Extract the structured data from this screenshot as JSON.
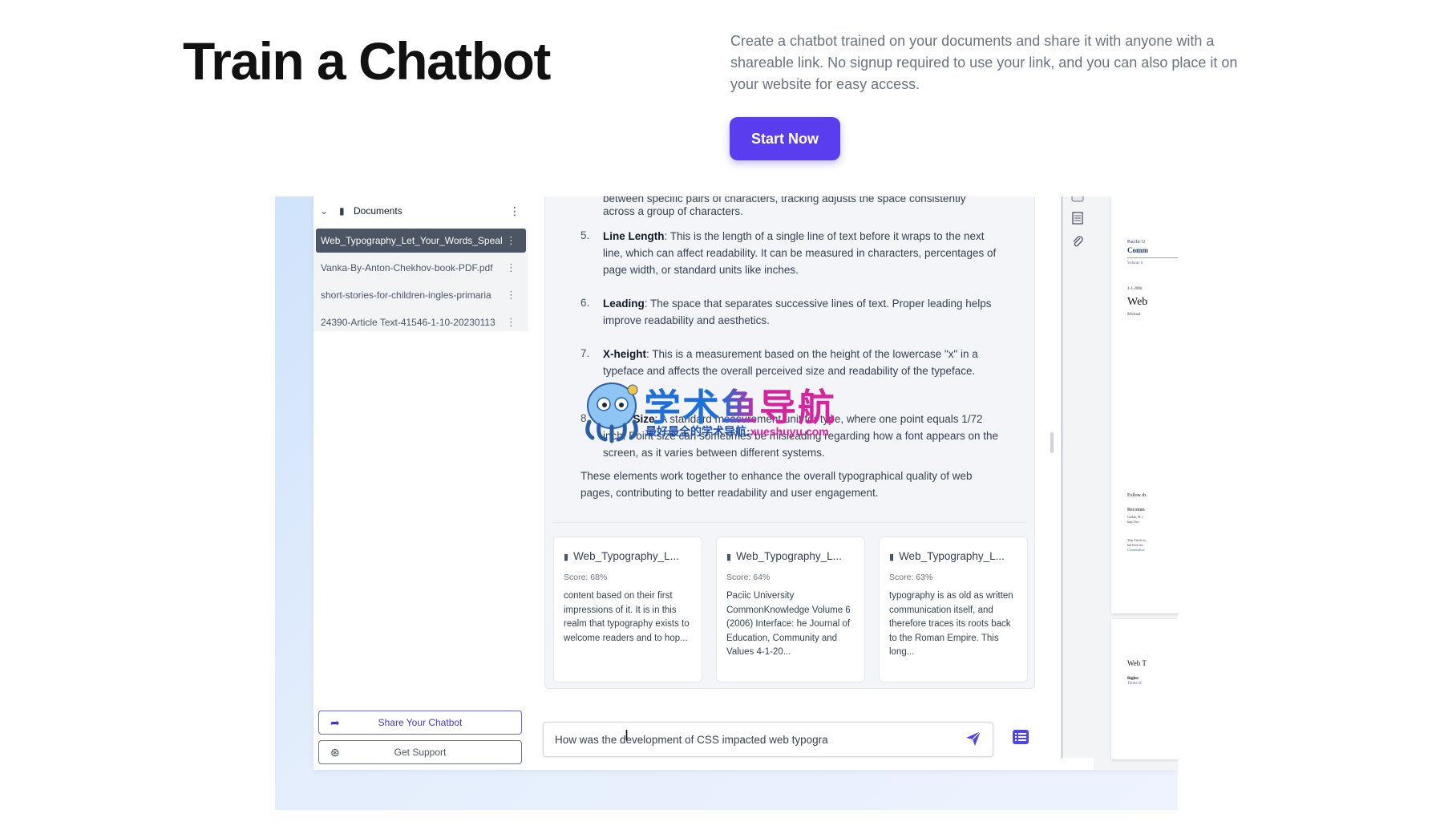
{
  "hero": {
    "title": "Train a Chatbot",
    "description": "Create a chatbot trained on your documents and share it with anyone with a shareable link. No signup required to use your link, and you can also place it on your website for easy access.",
    "cta": "Start Now"
  },
  "sidebar": {
    "section_label": "Documents",
    "documents": [
      "Web_Typography_Let_Your_Words_Speak",
      "Vanka-By-Anton-Chekhov-book-PDF.pdf",
      "short-stories-for-children-ingles-primaria",
      "24390-Article Text-41546-1-10-20230113"
    ],
    "active_index": 0,
    "share_label": "Share Your Chatbot",
    "support_label": "Get Support"
  },
  "chat": {
    "partial_top": "between specific pairs of characters, tracking adjusts the space consistently",
    "partial_top_2": "across a group of characters.",
    "items": [
      {
        "num": "5.",
        "term": "Line Length",
        "text": ": This is the length of a single line of text before it wraps to the next line, which can affect readability. It can be measured in characters, percentages of page width, or standard units like inches."
      },
      {
        "num": "6.",
        "term": "Leading",
        "text": ": The space that separates successive lines of text. Proper leading helps improve readability and aesthetics."
      },
      {
        "num": "7.",
        "term": "X-height",
        "text": ": This is a measurement based on the height of the lowercase \"x\" in a typeface and affects the overall perceived size and readability of the typeface."
      },
      {
        "num": "8.",
        "term": "Point Size",
        "text": ": A standard measurement unit for type, where one point equals 1/72 inch. Point size can sometimes be misleading regarding how a font appears on the screen, as it varies between different systems."
      }
    ],
    "summary": "These elements work together to enhance the overall typographical quality of web pages, contributing to better readability and user engagement.",
    "sources": [
      {
        "title": "Web_Typography_L...",
        "score": "Score: 68%",
        "snippet": "content based on their first impressions of it. It is in this realm that typography exists to welcome readers and to hop..."
      },
      {
        "title": "Web_Typography_L...",
        "score": "Score: 64%",
        "snippet": "Paciic University CommonKnowledge Volume 6 (2006) Interface: he Journal of Education, Community and Values 4-1-20..."
      },
      {
        "title": "Web_Typography_L...",
        "score": "Score: 63%",
        "snippet": "typography is as old as written communication itself, and therefore traces its roots back to the Roman Empire. This long..."
      }
    ],
    "input_value": "How was the development of CSS impacted web typogra"
  },
  "pdf_preview": {
    "p1_line1": "Pacific U",
    "p1_line2": "Comm",
    "p1_line3": "Volume 6",
    "p1_date": "4-1-2006",
    "p1_title": "Web",
    "p1_author": "Michael",
    "p1_follow": "Follow th",
    "p1_recom": "Recomm",
    "p1_cite1": "Gerlak, M. (",
    "p1_cite2": "http://hcc",
    "p1_note1": "This Article is",
    "p1_note2": "has been acc",
    "p1_note3": "CommonKno",
    "p2_title": "Web T",
    "p2_rights": "Rights",
    "p2_terms": "Terms of"
  },
  "watermark": {
    "main": "学术鱼导航",
    "sub_prefix": "最好最全的学术导航:",
    "sub_site": "xueshuyu.com"
  },
  "colors": {
    "accent": "#5b3df0",
    "active_doc": "#4b5563",
    "share": "#4338ca"
  }
}
